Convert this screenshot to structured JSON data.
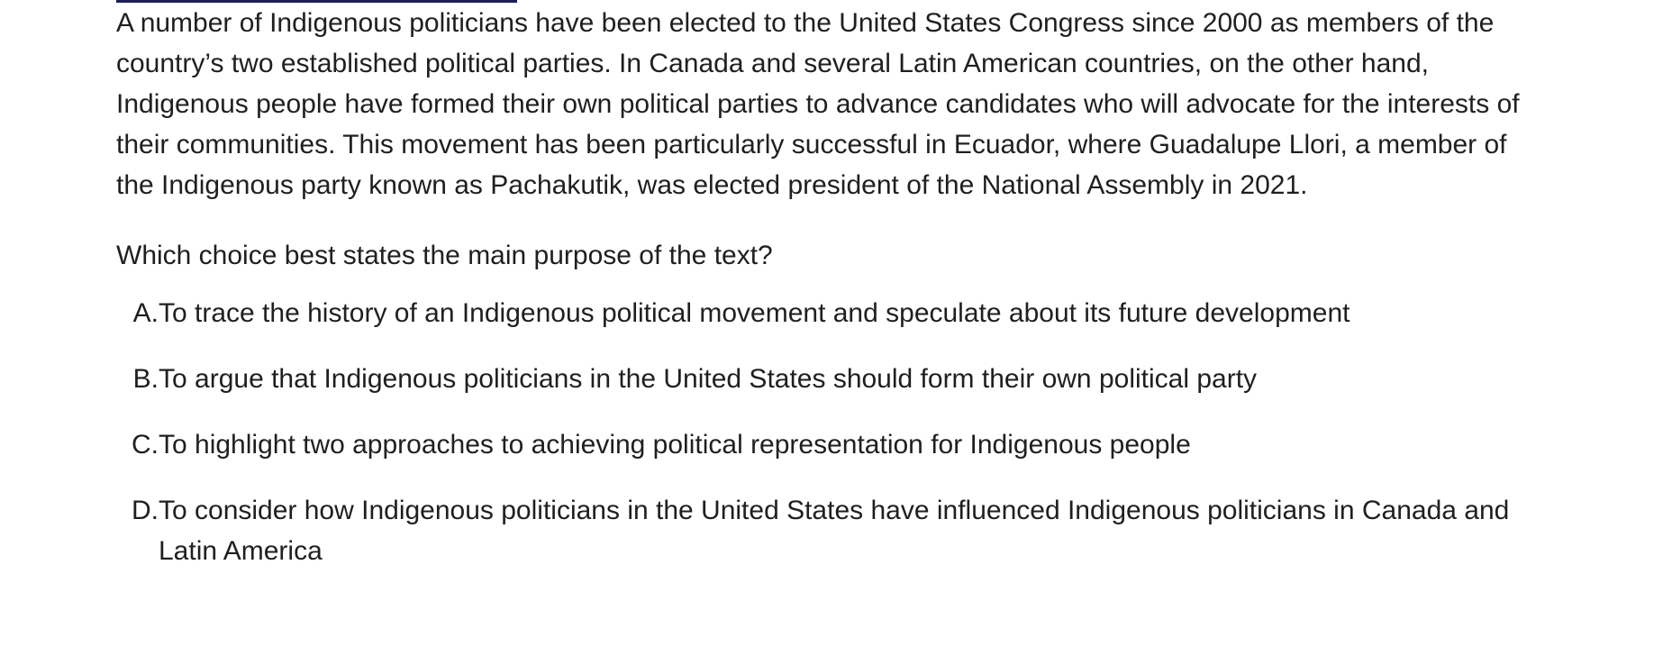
{
  "passage": "A number of Indigenous politicians have been elected to the United States Congress since 2000 as members of the country’s two established political parties. In Canada and several Latin American countries, on the other hand, Indigenous people have formed their own political parties to advance candidates who will advocate for the interests of their communities. This movement has been particularly successful in Ecuador, where Guadalupe Llori, a member of the Indigenous party known as Pachakutik, was elected president of the National Assembly in 2021.",
  "question": "Which choice best states the main purpose of the text?",
  "choices": [
    {
      "letter": "A",
      "text": "To trace the history of an Indigenous political movement and speculate about its future development"
    },
    {
      "letter": "B",
      "text": "To argue that Indigenous politicians in the United States should form their own political party"
    },
    {
      "letter": "C",
      "text": "To highlight two approaches to achieving political representation for Indigenous people"
    },
    {
      "letter": "D",
      "text": "To consider how Indigenous politicians in the United States have influenced Indigenous politicians in Canada and Latin America"
    }
  ],
  "colors": {
    "text": "#1f1f1f",
    "top_rule": "#1c2052",
    "background": "#ffffff"
  }
}
